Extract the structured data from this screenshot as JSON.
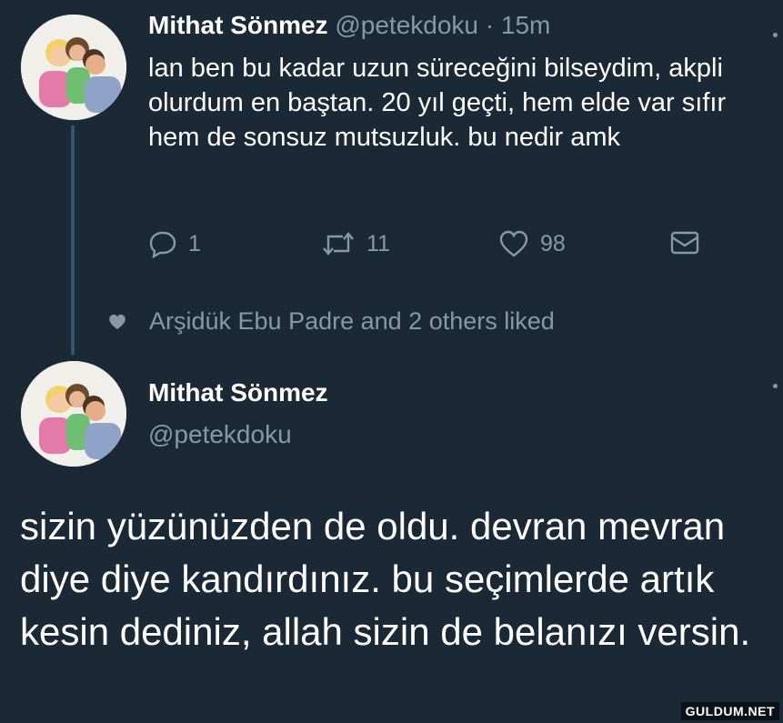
{
  "tweet1": {
    "name": "Mithat Sönmez",
    "handle": "@petekdoku",
    "separator": "·",
    "time": "15m",
    "text": "lan ben bu kadar uzun süreceğini bilseydim, akpli olurdum en baştan. 20 yıl geçti, hem elde var sıfır hem de sonsuz mutsuzluk. bu nedir amk",
    "replies": "1",
    "retweets": "11",
    "likes": "98"
  },
  "liked_by": {
    "text": "Arşidük Ebu Padre and 2 others liked"
  },
  "tweet2": {
    "name": "Mithat Sönmez",
    "handle": "@petekdoku",
    "text": "sizin yüzünüzden de oldu. devran mevran diye diye kandırdınız. bu seçimlerde artık kesin dediniz, allah sizin de belanızı versin."
  },
  "watermark": "GULDUM.NET",
  "icons": [
    "avatar-photo",
    "reply-icon",
    "retweet-icon",
    "heart-icon",
    "envelope-icon",
    "liked-heart-icon",
    "more-icon"
  ],
  "colors": {
    "background": "#1b2836",
    "text_primary": "#ffffff",
    "text_secondary": "#8899a6",
    "thread_line": "#3d5466"
  }
}
